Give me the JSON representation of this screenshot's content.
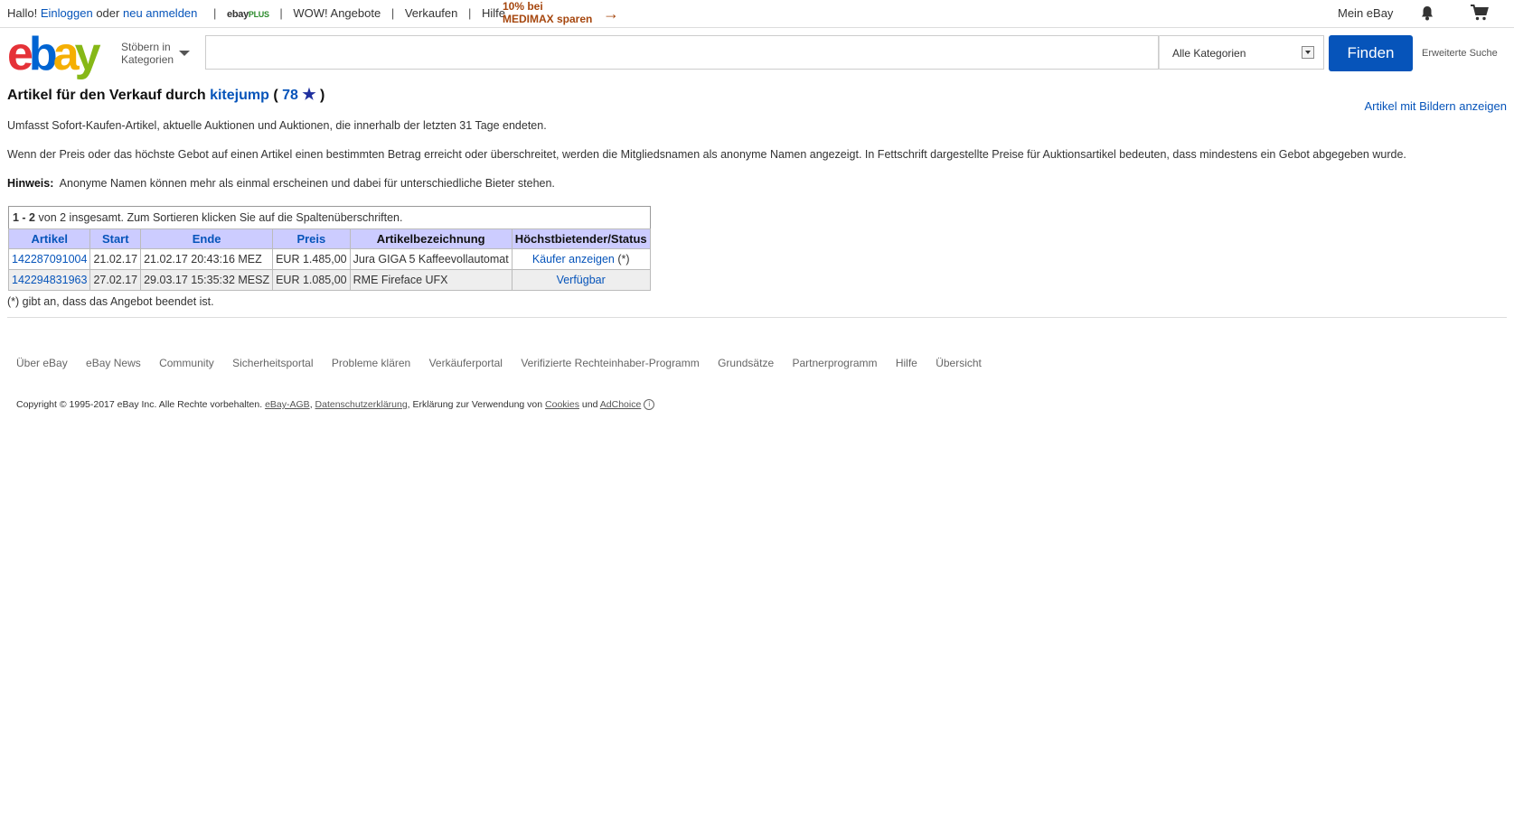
{
  "topbar": {
    "greeting": "Hallo!",
    "login": "Einloggen",
    "or": "oder",
    "register": "neu anmelden",
    "ebay_plus_ebay": "ebay",
    "ebay_plus_plus": "PLUS",
    "wow": "WOW! Angebote",
    "sell": "Verkaufen",
    "help": "Hilfe",
    "promo_line1": "10% bei",
    "promo_line2": "MEDIMAX sparen",
    "my_ebay": "Mein eBay"
  },
  "header": {
    "logo_e": "e",
    "logo_b": "b",
    "logo_a": "a",
    "logo_y": "y",
    "browse_line1": "Stöbern in",
    "browse_line2": "Kategorien",
    "search_placeholder": "",
    "category_selected": "Alle Kategorien",
    "find_label": "Finden",
    "advanced_search": "Erweiterte Suche"
  },
  "page": {
    "title_prefix": "Artikel für den Verkauf durch",
    "seller": "kitejump",
    "open_paren": "(",
    "feedback_score": "78",
    "close_paren": ")",
    "with_images_link": "Artikel mit Bildern anzeigen",
    "intro": "Umfasst Sofort-Kaufen-Artikel, aktuelle Auktionen und Auktionen, die innerhalb der letzten 31 Tage endeten.",
    "price_note": "Wenn der Preis oder das höchste Gebot auf einen Artikel einen bestimmten Betrag erreicht oder überschreitet, werden die Mitgliedsnamen als anonyme Namen angezeigt. In Fettschrift dargestellte Preise für Auktionsartikel bedeuten, dass mindestens ein Gebot abgegeben wurde.",
    "hint_label": "Hinweis:",
    "hint_text": "Anonyme Namen können mehr als einmal erscheinen und dabei für unterschiedliche Bieter stehen.",
    "ended_note": "(*) gibt an, dass das Angebot beendet ist."
  },
  "table": {
    "summary_range": "1 - 2",
    "summary_text": "von 2 insgesamt. Zum Sortieren klicken Sie auf die Spaltenüberschriften.",
    "headers": [
      "Artikel",
      "Start",
      "Ende",
      "Preis",
      "Artikelbezeichnung",
      "Höchstbietender/Status"
    ],
    "rows": [
      {
        "item": "142287091004",
        "start": "21.02.17",
        "end": "21.02.17 20:43:16 MEZ",
        "price": "EUR 1.485,00",
        "title": "Jura GIGA 5 Kaffeevollautomat",
        "status_link": "Käufer anzeigen",
        "status_suffix": "(*)"
      },
      {
        "item": "142294831963",
        "start": "27.02.17",
        "end": "29.03.17 15:35:32 MESZ",
        "price": "EUR 1.085,00",
        "title": "RME Fireface UFX",
        "status_link": "Verfügbar",
        "status_suffix": ""
      }
    ]
  },
  "footer": {
    "links": [
      "Über eBay",
      "eBay News",
      "Community",
      "Sicherheitsportal",
      "Probleme klären",
      "Verkäuferportal",
      "Verifizierte Rechteinhaber-Programm",
      "Grundsätze",
      "Partnerprogramm",
      "Hilfe",
      "Übersicht"
    ],
    "copyright_text": "Copyright © 1995-2017 eBay Inc. Alle Rechte vorbehalten.",
    "agb": "eBay-AGB",
    "privacy": "Datenschutzerklärung",
    "cookies_prefix": "Erklärung zur Verwendung von",
    "cookies": "Cookies",
    "and": "und",
    "adchoice": "AdChoice",
    "info_glyph": "i"
  },
  "colors": {
    "link": "#0654ba",
    "find_button": "#0654ba",
    "table_header_bg": "#ccccff",
    "promo": "#a6470f"
  }
}
